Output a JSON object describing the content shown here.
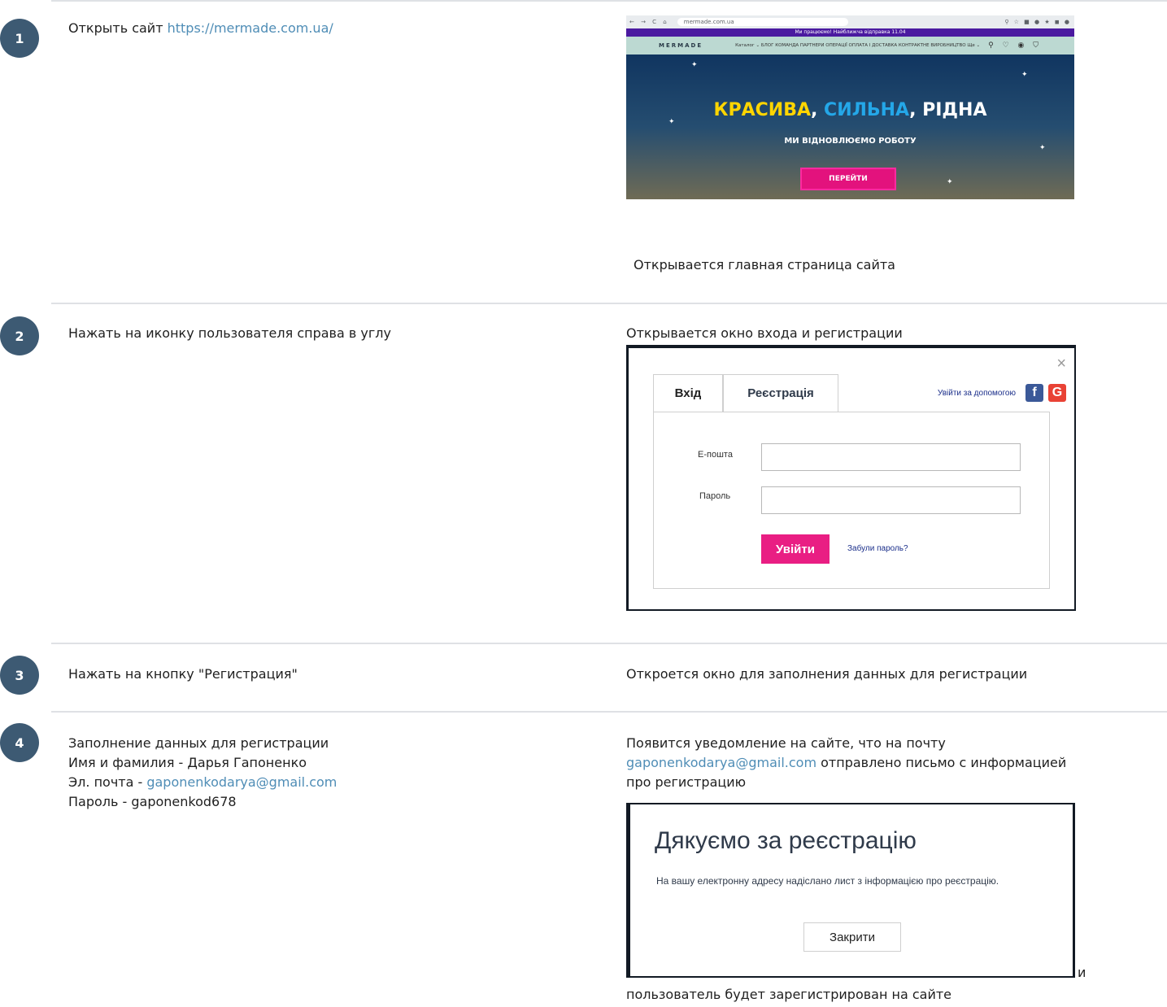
{
  "steps": [
    {
      "number": "1",
      "action_prefix": "Открыть сайт ",
      "action_link": "https://mermade.com.ua/",
      "result": "Открывается главная страница сайта"
    },
    {
      "number": "2",
      "action": "Нажать на иконку пользователя справа в углу",
      "result": "Открывается окно входа и регистрации"
    },
    {
      "number": "3",
      "action": "Нажать на кнопку \"Регистрация\"",
      "result": "Откроется окно для заполнения данных для регистрации"
    },
    {
      "number": "4",
      "action_lines": [
        "Заполнение данных для регистрации",
        "Имя и фамилия - Дарья Гапоненко"
      ],
      "email_prefix": "Эл. почта - ",
      "email": "gaponenkodarya@gmail.com",
      "password_line": "Пароль - gaponenkod678",
      "result_line1": "Появится уведомление на сайте, что на почту",
      "result_email": "gaponenkodarya@gmail.com",
      "result_line2_rest": " отправлено письмо с информацией",
      "result_line3": "про регистрацию",
      "result_trail": "и",
      "result_final": "пользователь будет зарегистрирован на сайте"
    }
  ],
  "shot_site": {
    "url": "mermade.com.ua",
    "promo": "Ми працюємо! Найближча відправка 11.04",
    "logo": "MERMADE",
    "menu": "Каталог ⌄   БЛОГ   КОМАНДА   ПАРТНЕРИ   ОПЕРАЦІЇ   ОПЛАТА І ДОСТАВКА   КОНТРАКТНЕ ВИРОБНИЦТВО   Ще ⌄",
    "hero_word1": "КРАСИВА",
    "hero_sep1": ", ",
    "hero_word2": "СИЛЬНА",
    "hero_sep2": ", ",
    "hero_word3": "РІДНА",
    "hero_sub": "МИ ВІДНОВЛЮЄМО РОБОТУ",
    "hero_button": "ПЕРЕЙТИ"
  },
  "shot_login": {
    "close": "×",
    "tab_login": "Вхід",
    "tab_register": "Реєстрація",
    "social_label": "Увійти за допомогою",
    "fb_glyph": "f",
    "google_glyph": "G",
    "email_label": "Е-пошта",
    "password_label": "Пароль",
    "login_button": "Увійти",
    "forgot": "Забули пароль?"
  },
  "shot_thanks": {
    "title": "Дякуємо за реєстрацію",
    "text": "На вашу електронну адресу надіслано лист з інформацією про реєстрацію.",
    "close_button": "Закрити"
  },
  "colors": {
    "badge": "#3d5a73",
    "link": "#4f8db6",
    "accent_pink": "#e91e83"
  }
}
